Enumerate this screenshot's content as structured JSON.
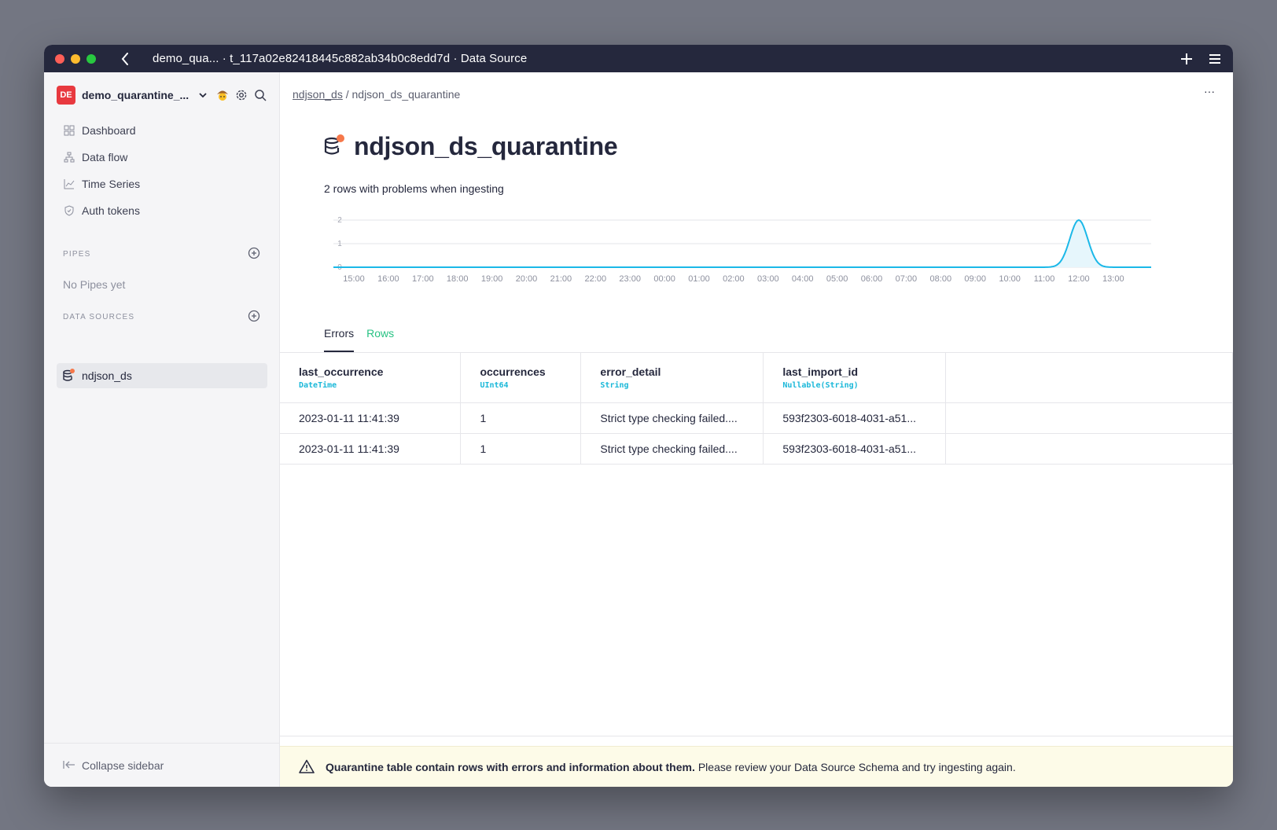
{
  "window": {
    "title": "demo_qua... · t_117a02e82418445c882ab34b0c8edd7d · Data Source",
    "traffic_colors": [
      "#ff5f57",
      "#febc2e",
      "#28c840"
    ]
  },
  "sidebar": {
    "workspace": {
      "badge": "DE",
      "name": "demo_quarantine_...",
      "badge_color": "#e8393f"
    },
    "nav": [
      {
        "label": "Dashboard",
        "icon": "grid-icon"
      },
      {
        "label": "Data flow",
        "icon": "flow-icon"
      },
      {
        "label": "Time Series",
        "icon": "chart-line-icon"
      },
      {
        "label": "Auth tokens",
        "icon": "shield-icon"
      }
    ],
    "pipes_label": "PIPES",
    "pipes_empty": "No Pipes yet",
    "datasources_label": "DATA SOURCES",
    "datasources": [
      {
        "label": "ndjson_ds",
        "icon": "database-icon"
      }
    ],
    "collapse_label": "Collapse sidebar"
  },
  "main": {
    "breadcrumb_parent": "ndjson_ds",
    "breadcrumb_separator": "/",
    "breadcrumb_current": "ndjson_ds_quarantine",
    "more_label": "···",
    "title": "ndjson_ds_quarantine",
    "subtitle": "2 rows with problems when ingesting",
    "tabs": [
      {
        "label": "Errors",
        "active": true
      },
      {
        "label": "Rows",
        "active": false
      }
    ],
    "columns": [
      {
        "name": "last_occurrence",
        "type": "DateTime"
      },
      {
        "name": "occurrences",
        "type": "UInt64"
      },
      {
        "name": "error_detail",
        "type": "String"
      },
      {
        "name": "last_import_id",
        "type": "Nullable(String)"
      }
    ],
    "rows": [
      [
        "2023-01-11 11:41:39",
        "1",
        "Strict type checking failed....",
        "593f2303-6018-4031-a51..."
      ],
      [
        "2023-01-11 11:41:39",
        "1",
        "Strict type checking failed....",
        "593f2303-6018-4031-a51..."
      ]
    ],
    "banner_bold": "Quarantine table contain rows with errors and information about them.",
    "banner_text": "Please review your Data Source Schema and try ingesting again."
  },
  "chart_data": {
    "type": "area",
    "x": [
      "15:00",
      "16:00",
      "17:00",
      "18:00",
      "19:00",
      "20:00",
      "21:00",
      "22:00",
      "23:00",
      "00:00",
      "01:00",
      "02:00",
      "03:00",
      "04:00",
      "05:00",
      "06:00",
      "07:00",
      "08:00",
      "09:00",
      "10:00",
      "11:00",
      "12:00",
      "13:00"
    ],
    "values": [
      0,
      0,
      0,
      0,
      0,
      0,
      0,
      0,
      0,
      0,
      0,
      0,
      0,
      0,
      0,
      0,
      0,
      0,
      0,
      0,
      0,
      2,
      0
    ],
    "yticks": [
      "0",
      "1",
      "2"
    ],
    "ylim": [
      0,
      2
    ],
    "line_color": "#1bb8e8",
    "fill_color": "#e6f6fc",
    "title": "",
    "xlabel": "",
    "ylabel": ""
  }
}
